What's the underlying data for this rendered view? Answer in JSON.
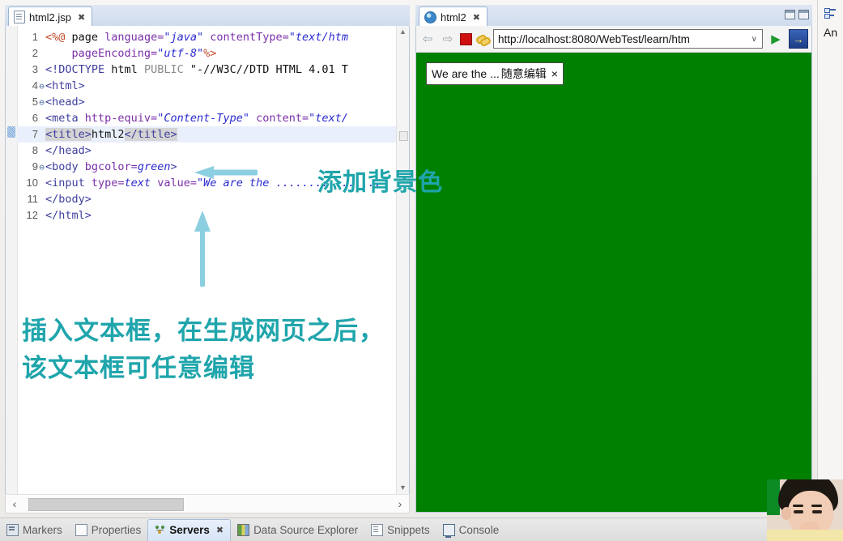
{
  "editor": {
    "tab": {
      "label": "html2.jsp",
      "icon": "jsp-file-icon",
      "close": "✖"
    },
    "lines": [
      {
        "n": "1",
        "fold": "",
        "highlight": false,
        "segments": [
          {
            "t": "<%@",
            "c": "t-dir"
          },
          {
            "t": " page ",
            "c": "t-plain"
          },
          {
            "t": "language=",
            "c": "t-attr"
          },
          {
            "t": "\"java\"",
            "c": "t-str"
          },
          {
            "t": " ",
            "c": "t-plain"
          },
          {
            "t": "contentType=",
            "c": "t-attr"
          },
          {
            "t": "\"text/htm",
            "c": "t-str"
          }
        ]
      },
      {
        "n": "2",
        "fold": "",
        "highlight": false,
        "segments": [
          {
            "t": "    ",
            "c": "t-plain"
          },
          {
            "t": "pageEncoding=",
            "c": "t-attr"
          },
          {
            "t": "\"utf-8\"",
            "c": "t-str"
          },
          {
            "t": "%>",
            "c": "t-dir"
          }
        ]
      },
      {
        "n": "3",
        "fold": "",
        "highlight": false,
        "segments": [
          {
            "t": "<!DOCTYPE",
            "c": "t-tag"
          },
          {
            "t": " html ",
            "c": "t-plain"
          },
          {
            "t": "PUBLIC",
            "c": "t-gray"
          },
          {
            "t": " ",
            "c": "t-plain"
          },
          {
            "t": "\"-//W3C//DTD HTML 4.01 T",
            "c": "t-plain"
          }
        ]
      },
      {
        "n": "4",
        "fold": "⊖",
        "highlight": false,
        "segments": [
          {
            "t": "<html>",
            "c": "t-tag"
          }
        ]
      },
      {
        "n": "5",
        "fold": "⊖",
        "highlight": false,
        "segments": [
          {
            "t": "<head>",
            "c": "t-tag"
          }
        ]
      },
      {
        "n": "6",
        "fold": "",
        "highlight": false,
        "segments": [
          {
            "t": "<meta ",
            "c": "t-tag"
          },
          {
            "t": "http-equiv=",
            "c": "t-attr"
          },
          {
            "t": "\"Content-Type\"",
            "c": "t-str"
          },
          {
            "t": " ",
            "c": "t-plain"
          },
          {
            "t": "content=",
            "c": "t-attr"
          },
          {
            "t": "\"text/",
            "c": "t-str"
          }
        ]
      },
      {
        "n": "7",
        "fold": "",
        "highlight": true,
        "segments": [
          {
            "t": "<title>",
            "c": "t-sel"
          },
          {
            "t": "html2",
            "c": "t-plain"
          },
          {
            "t": "</title>",
            "c": "t-sel"
          }
        ]
      },
      {
        "n": "8",
        "fold": "",
        "highlight": false,
        "segments": [
          {
            "t": "</head>",
            "c": "t-tag"
          }
        ]
      },
      {
        "n": "9",
        "fold": "⊖",
        "highlight": false,
        "segments": [
          {
            "t": "<body ",
            "c": "t-tag"
          },
          {
            "t": "bgcolor=",
            "c": "t-attr"
          },
          {
            "t": "green",
            "c": "t-str"
          },
          {
            "t": ">",
            "c": "t-tag"
          }
        ]
      },
      {
        "n": "10",
        "fold": "",
        "highlight": false,
        "segments": [
          {
            "t": "<input ",
            "c": "t-tag"
          },
          {
            "t": "type=",
            "c": "t-attr"
          },
          {
            "t": "text",
            "c": "t-str"
          },
          {
            "t": " ",
            "c": "t-plain"
          },
          {
            "t": "value=",
            "c": "t-attr"
          },
          {
            "t": "\"We are the ",
            "c": "t-str"
          },
          {
            "t": "................",
            "c": "t-str"
          }
        ]
      },
      {
        "n": "11",
        "fold": "",
        "highlight": false,
        "segments": [
          {
            "t": "</body>",
            "c": "t-tag"
          }
        ]
      },
      {
        "n": "12",
        "fold": "",
        "highlight": false,
        "segments": [
          {
            "t": "</html>",
            "c": "t-tag"
          }
        ]
      }
    ],
    "scroll": {
      "up": "▲",
      "down": "▼",
      "left": "‹",
      "right": "›"
    }
  },
  "browser": {
    "tab": {
      "label": "html2",
      "icon": "globe-icon",
      "close": "✖"
    },
    "toolbar": {
      "back": "⇦",
      "forward": "⇨",
      "stop": "stop-icon",
      "link": "link-icon",
      "url": "http://localhost:8080/WebTest/learn/htm",
      "url_caret": "∨",
      "go": "▶",
      "open_external": "→"
    },
    "page": {
      "bgcolor": "#008000",
      "input_value": "We are the ...",
      "ime_text": "随意编辑",
      "ime_close": "×"
    }
  },
  "outline": {
    "label": "An",
    "icon": "outline-view-icon"
  },
  "bottom_tabs": [
    {
      "label": "Markers",
      "icon": "markers-icon",
      "active": false
    },
    {
      "label": "Properties",
      "icon": "properties-icon",
      "active": false
    },
    {
      "label": "Servers",
      "icon": "servers-icon",
      "active": true,
      "close": "✖"
    },
    {
      "label": "Data Source Explorer",
      "icon": "data-source-icon",
      "active": false
    },
    {
      "label": "Snippets",
      "icon": "snippets-icon",
      "active": false
    },
    {
      "label": "Console",
      "icon": "console-icon",
      "active": false
    }
  ],
  "annotations": {
    "bgcolor_note": "添加背景色",
    "textbox_note": "插入文本框，在生成网页之后，该文本框可任意编辑",
    "color": "#1fa5ab"
  }
}
